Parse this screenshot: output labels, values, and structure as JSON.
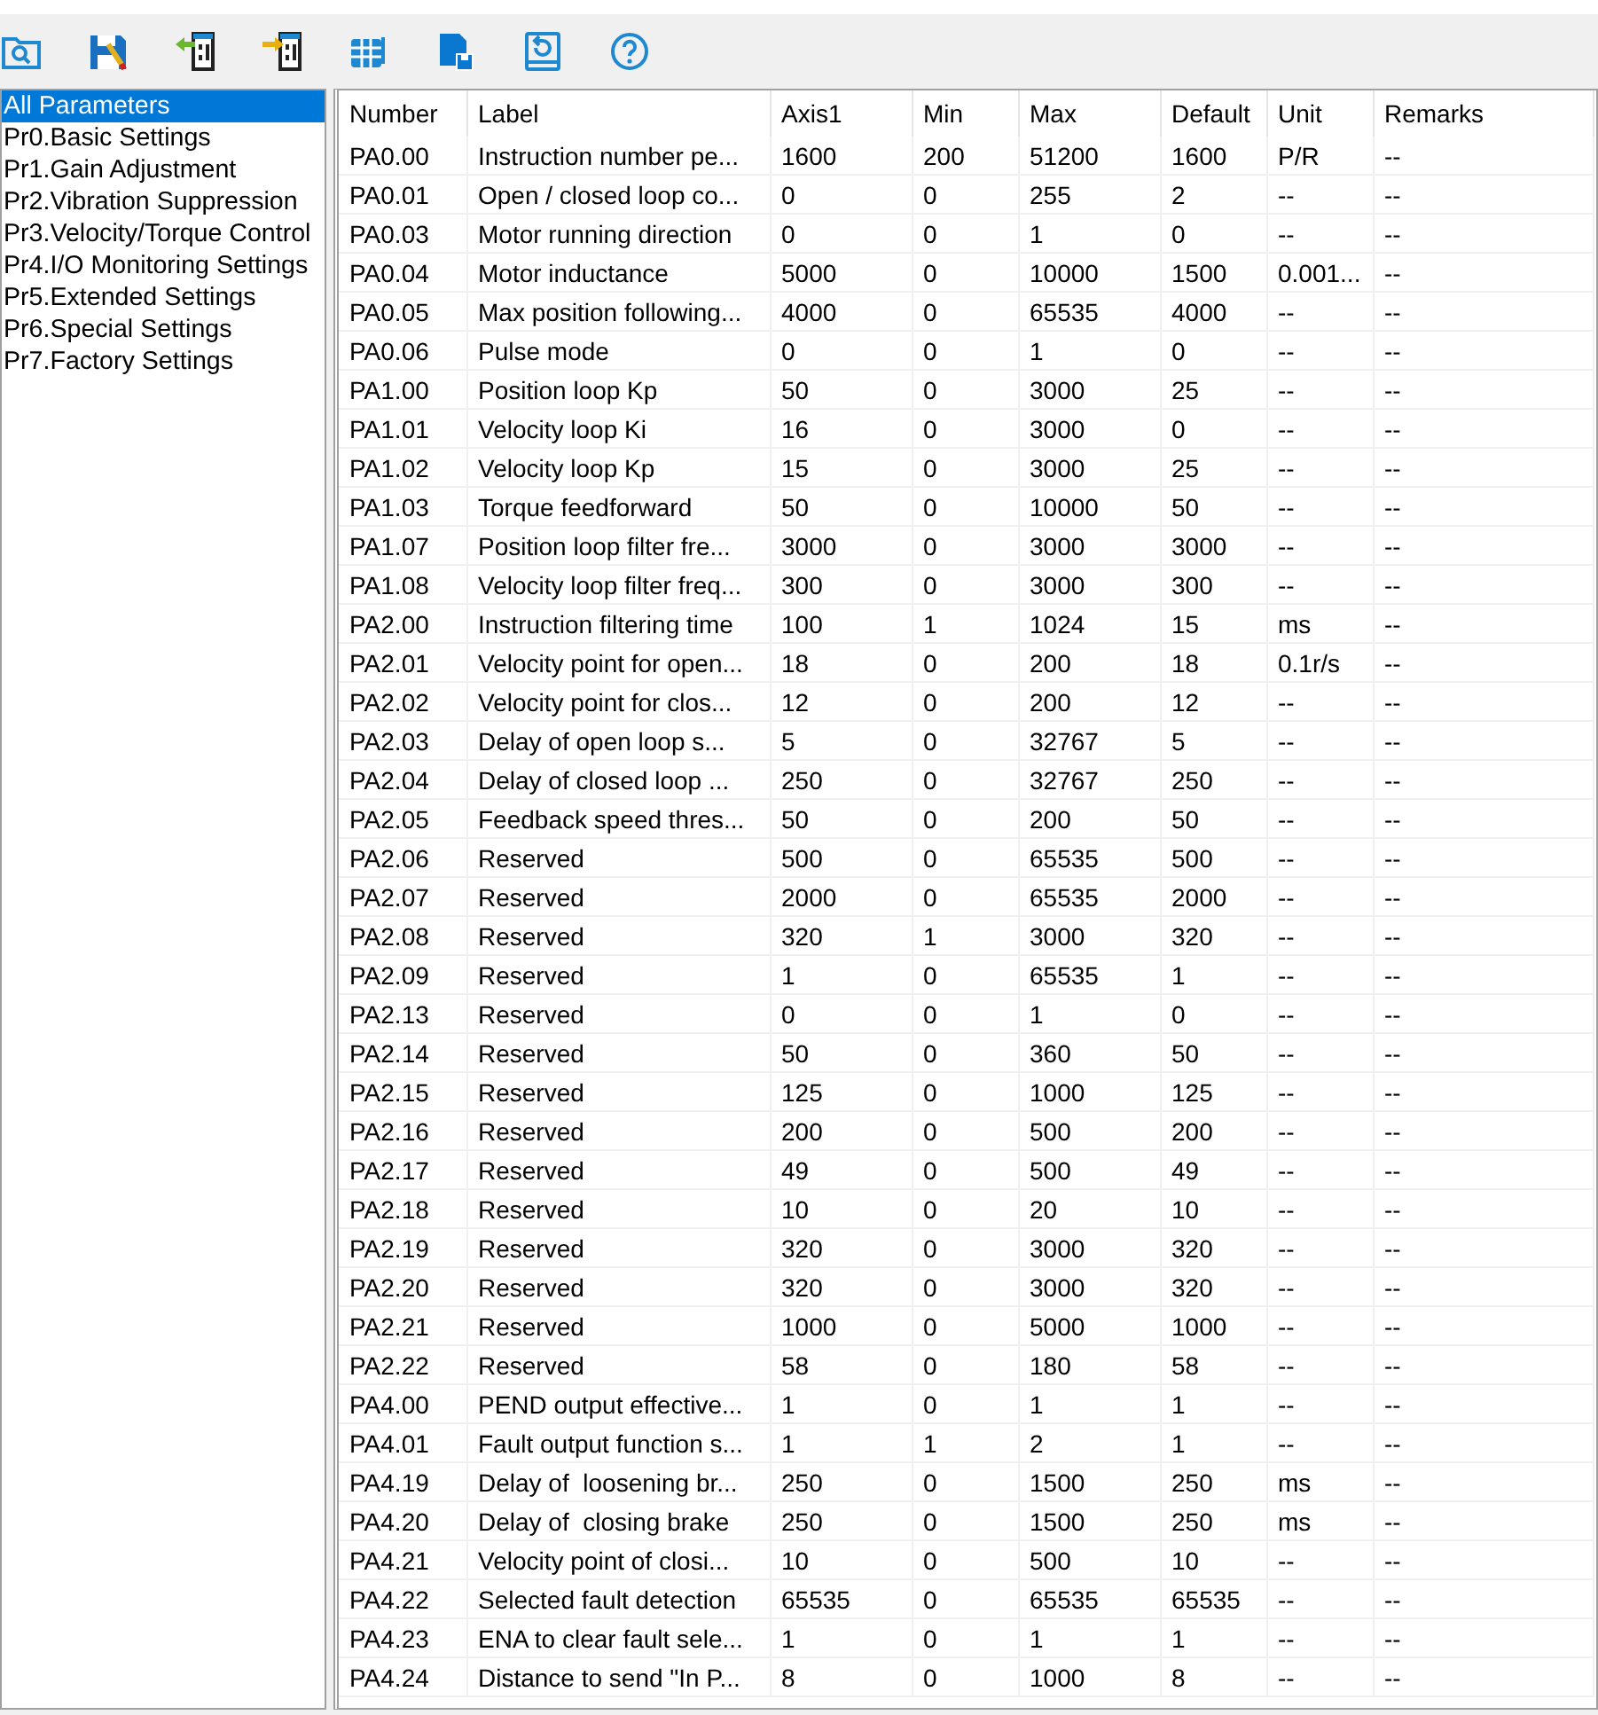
{
  "toolbar": {
    "icons": [
      {
        "kind": "folder-search"
      },
      {
        "kind": "save"
      },
      {
        "kind": "import"
      },
      {
        "kind": "export"
      },
      {
        "kind": "table"
      },
      {
        "kind": "save-file"
      },
      {
        "kind": "restore"
      },
      {
        "kind": "help"
      }
    ]
  },
  "sidebar": {
    "items": [
      {
        "label": "All Parameters",
        "selected": true
      },
      {
        "label": "Pr0.Basic Settings",
        "selected": false
      },
      {
        "label": "Pr1.Gain Adjustment",
        "selected": false
      },
      {
        "label": "Pr2.Vibration Suppression",
        "selected": false
      },
      {
        "label": "Pr3.Velocity/Torque Control",
        "selected": false
      },
      {
        "label": "Pr4.I/O Monitoring Settings",
        "selected": false
      },
      {
        "label": "Pr5.Extended Settings",
        "selected": false
      },
      {
        "label": "Pr6.Special Settings",
        "selected": false
      },
      {
        "label": "Pr7.Factory Settings",
        "selected": false
      }
    ]
  },
  "table": {
    "columns": [
      "Number",
      "Label",
      "Axis1",
      "Min",
      "Max",
      "Default",
      "Unit",
      "Remarks"
    ],
    "rows": [
      [
        "PA0.00",
        "Instruction number pe...",
        "1600",
        "200",
        "51200",
        "1600",
        "P/R",
        "--"
      ],
      [
        "PA0.01",
        "Open / closed loop co...",
        "0",
        "0",
        "255",
        "2",
        "--",
        "--"
      ],
      [
        "PA0.03",
        "Motor running direction",
        "0",
        "0",
        "1",
        "0",
        "--",
        "--"
      ],
      [
        "PA0.04",
        "Motor inductance",
        "5000",
        "0",
        "10000",
        "1500",
        "0.001...",
        "--"
      ],
      [
        "PA0.05",
        "Max position following...",
        "4000",
        "0",
        "65535",
        "4000",
        "--",
        "--"
      ],
      [
        "PA0.06",
        "Pulse mode",
        "0",
        "0",
        "1",
        "0",
        "--",
        "--"
      ],
      [
        "PA1.00",
        "Position loop Kp",
        "50",
        "0",
        "3000",
        "25",
        "--",
        "--"
      ],
      [
        "PA1.01",
        "Velocity loop Ki",
        "16",
        "0",
        "3000",
        "0",
        "--",
        "--"
      ],
      [
        "PA1.02",
        "Velocity loop Kp",
        "15",
        "0",
        "3000",
        "25",
        "--",
        "--"
      ],
      [
        "PA1.03",
        "Torque feedforward",
        "50",
        "0",
        "10000",
        "50",
        "--",
        "--"
      ],
      [
        "PA1.07",
        "Position loop filter fre...",
        "3000",
        "0",
        "3000",
        "3000",
        "--",
        "--"
      ],
      [
        "PA1.08",
        "Velocity loop filter freq...",
        "300",
        "0",
        "3000",
        "300",
        "--",
        "--"
      ],
      [
        "PA2.00",
        "Instruction filtering time",
        "100",
        "1",
        "1024",
        "15",
        "ms",
        "--"
      ],
      [
        "PA2.01",
        "Velocity point for open...",
        "18",
        "0",
        "200",
        "18",
        "0.1r/s",
        "--"
      ],
      [
        "PA2.02",
        "Velocity point for clos...",
        "12",
        "0",
        "200",
        "12",
        "--",
        "--"
      ],
      [
        "PA2.03",
        "Delay of open loop s...",
        "5",
        "0",
        "32767",
        "5",
        "--",
        "--"
      ],
      [
        "PA2.04",
        "Delay of closed loop ...",
        "250",
        "0",
        "32767",
        "250",
        "--",
        "--"
      ],
      [
        "PA2.05",
        "Feedback speed thres...",
        "50",
        "0",
        "200",
        "50",
        "--",
        "--"
      ],
      [
        "PA2.06",
        "Reserved",
        "500",
        "0",
        "65535",
        "500",
        "--",
        "--"
      ],
      [
        "PA2.07",
        "Reserved",
        "2000",
        "0",
        "65535",
        "2000",
        "--",
        "--"
      ],
      [
        "PA2.08",
        "Reserved",
        "320",
        "1",
        "3000",
        "320",
        "--",
        "--"
      ],
      [
        "PA2.09",
        "Reserved",
        "1",
        "0",
        "65535",
        "1",
        "--",
        "--"
      ],
      [
        "PA2.13",
        "Reserved",
        "0",
        "0",
        "1",
        "0",
        "--",
        "--"
      ],
      [
        "PA2.14",
        "Reserved",
        "50",
        "0",
        "360",
        "50",
        "--",
        "--"
      ],
      [
        "PA2.15",
        "Reserved",
        "125",
        "0",
        "1000",
        "125",
        "--",
        "--"
      ],
      [
        "PA2.16",
        "Reserved",
        "200",
        "0",
        "500",
        "200",
        "--",
        "--"
      ],
      [
        "PA2.17",
        "Reserved",
        "49",
        "0",
        "500",
        "49",
        "--",
        "--"
      ],
      [
        "PA2.18",
        "Reserved",
        "10",
        "0",
        "20",
        "10",
        "--",
        "--"
      ],
      [
        "PA2.19",
        "Reserved",
        "320",
        "0",
        "3000",
        "320",
        "--",
        "--"
      ],
      [
        "PA2.20",
        "Reserved",
        "320",
        "0",
        "3000",
        "320",
        "--",
        "--"
      ],
      [
        "PA2.21",
        "Reserved",
        "1000",
        "0",
        "5000",
        "1000",
        "--",
        "--"
      ],
      [
        "PA2.22",
        "Reserved",
        "58",
        "0",
        "180",
        "58",
        "--",
        "--"
      ],
      [
        "PA4.00",
        "PEND output effective...",
        "1",
        "0",
        "1",
        "1",
        "--",
        "--"
      ],
      [
        "PA4.01",
        "Fault output function s...",
        "1",
        "1",
        "2",
        "1",
        "--",
        "--"
      ],
      [
        "PA4.19",
        "Delay of  loosening br...",
        "250",
        "0",
        "1500",
        "250",
        "ms",
        "--"
      ],
      [
        "PA4.20",
        "Delay of  closing brake",
        "250",
        "0",
        "1500",
        "250",
        "ms",
        "--"
      ],
      [
        "PA4.21",
        "Velocity point of closi...",
        "10",
        "0",
        "500",
        "10",
        "--",
        "--"
      ],
      [
        "PA4.22",
        "Selected fault detection",
        "65535",
        "0",
        "65535",
        "65535",
        "--",
        "--"
      ],
      [
        "PA4.23",
        "ENA to clear fault sele...",
        "1",
        "0",
        "1",
        "1",
        "--",
        "--"
      ],
      [
        "PA4.24",
        "Distance to send \"In P...",
        "8",
        "0",
        "1000",
        "8",
        "--",
        "--"
      ]
    ]
  }
}
